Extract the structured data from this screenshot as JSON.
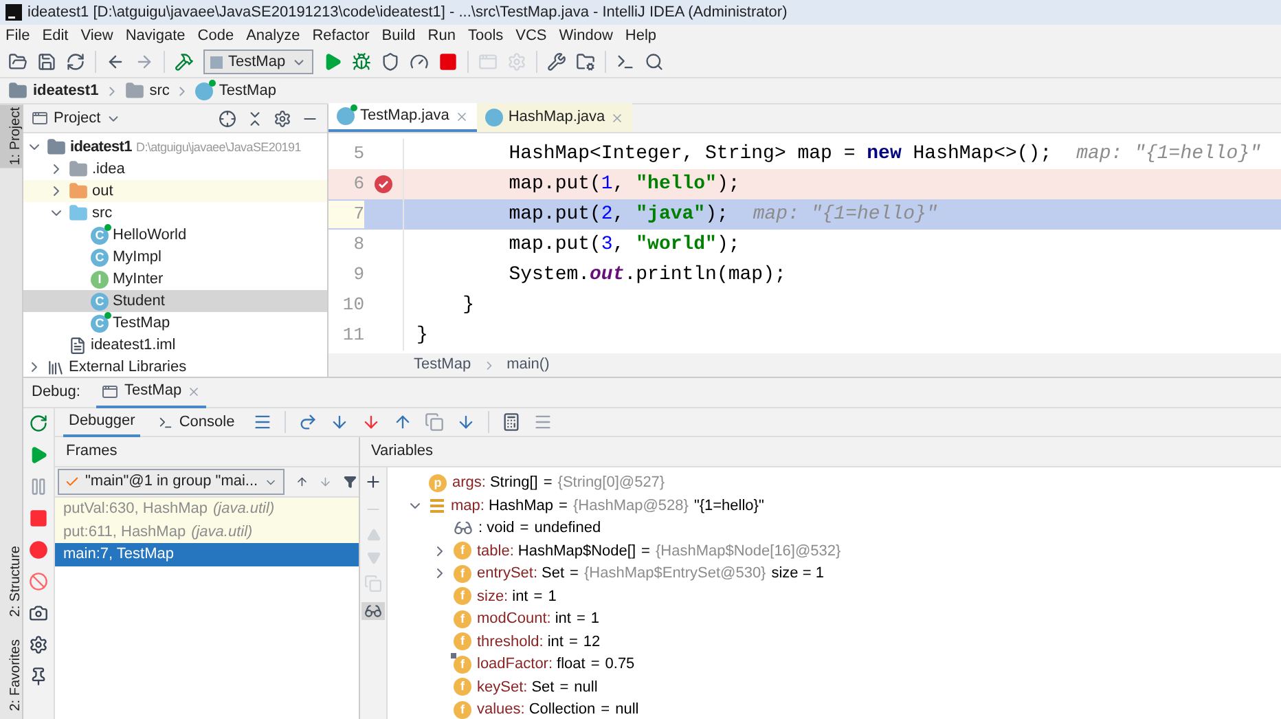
{
  "window": {
    "title": "ideatest1 [D:\\atguigu\\javaee\\JavaSE20191213\\code\\ideatest1] - ...\\src\\TestMap.java - IntelliJ IDEA (Administrator)"
  },
  "menu": [
    "File",
    "Edit",
    "View",
    "Navigate",
    "Code",
    "Analyze",
    "Refactor",
    "Build",
    "Run",
    "Tools",
    "VCS",
    "Window",
    "Help"
  ],
  "toolbar": {
    "run_config": "TestMap"
  },
  "breadcrumb": [
    {
      "label": "ideatest1",
      "kind": "module"
    },
    {
      "label": "src",
      "kind": "folder"
    },
    {
      "label": "TestMap",
      "kind": "class"
    }
  ],
  "tool_stripe": [
    {
      "label": "1: Project",
      "selected": true
    },
    {
      "label": "2: Structure",
      "selected": false
    },
    {
      "label": "2: Favorites",
      "selected": false
    }
  ],
  "project": {
    "title": "Project",
    "tree": [
      {
        "label": "ideatest1",
        "path": "D:\\atguigu\\javaee\\JavaSE20191",
        "kind": "module",
        "expanded": true,
        "selected": false,
        "children": [
          {
            "label": ".idea",
            "kind": "folder",
            "expanded": false,
            "selected": false
          },
          {
            "label": "out",
            "kind": "excluded",
            "expanded": false,
            "selected": false
          },
          {
            "label": "src",
            "kind": "source",
            "expanded": true,
            "selected": false,
            "children": [
              {
                "label": "HelloWorld",
                "kind": "main-class",
                "badge": "C",
                "selected": false
              },
              {
                "label": "MyImpl",
                "kind": "class",
                "badge": "C",
                "selected": false
              },
              {
                "label": "MyInter",
                "kind": "interface",
                "badge": "I",
                "selected": false
              },
              {
                "label": "Student",
                "kind": "class",
                "badge": "C",
                "selected": true
              },
              {
                "label": "TestMap",
                "kind": "main-class",
                "badge": "C",
                "selected": false
              }
            ]
          },
          {
            "label": "ideatest1.iml",
            "kind": "iml",
            "selected": false
          }
        ]
      },
      {
        "label": "External Libraries",
        "kind": "libraries",
        "expanded": false,
        "selected": false
      }
    ]
  },
  "editor": {
    "tabs": [
      {
        "label": "TestMap.java",
        "kind": "main-class",
        "selected": true
      },
      {
        "label": "HashMap.java",
        "kind": "class",
        "selected": false
      }
    ],
    "lines": [
      {
        "number": "5",
        "breakpoint": false,
        "current": false,
        "tokens": [
          {
            "kind": "plain",
            "text": "        HashMap<Integer, String> map = "
          },
          {
            "kind": "keyword",
            "text": "new"
          },
          {
            "kind": "plain",
            "text": " HashMap<>();"
          },
          {
            "kind": "hint",
            "text": "map: \"{1=hello}\""
          }
        ]
      },
      {
        "number": "6",
        "breakpoint": true,
        "current": false,
        "tokens": [
          {
            "kind": "plain",
            "text": "        map.put("
          },
          {
            "kind": "number",
            "text": "1"
          },
          {
            "kind": "plain",
            "text": ", "
          },
          {
            "kind": "string",
            "text": "\"hello\""
          },
          {
            "kind": "plain",
            "text": ");"
          }
        ]
      },
      {
        "number": "7",
        "breakpoint": false,
        "current": true,
        "tokens": [
          {
            "kind": "plain",
            "text": "        map.put("
          },
          {
            "kind": "number",
            "text": "2"
          },
          {
            "kind": "plain",
            "text": ", "
          },
          {
            "kind": "string",
            "text": "\"java\""
          },
          {
            "kind": "plain",
            "text": ");"
          },
          {
            "kind": "hint",
            "text": "map: \"{1=hello}\""
          }
        ]
      },
      {
        "number": "8",
        "breakpoint": false,
        "current": false,
        "tokens": [
          {
            "kind": "plain",
            "text": "        map.put("
          },
          {
            "kind": "number",
            "text": "3"
          },
          {
            "kind": "plain",
            "text": ", "
          },
          {
            "kind": "string",
            "text": "\"world\""
          },
          {
            "kind": "plain",
            "text": ");"
          }
        ]
      },
      {
        "number": "9",
        "breakpoint": false,
        "current": false,
        "tokens": [
          {
            "kind": "plain",
            "text": "        System."
          },
          {
            "kind": "static",
            "text": "out"
          },
          {
            "kind": "plain",
            "text": ".println(map);"
          }
        ]
      },
      {
        "number": "10",
        "breakpoint": false,
        "current": false,
        "tokens": [
          {
            "kind": "plain",
            "text": "    }"
          }
        ]
      },
      {
        "number": "11",
        "breakpoint": false,
        "current": false,
        "tokens": [
          {
            "kind": "plain",
            "text": "}"
          }
        ]
      }
    ],
    "footer": [
      "TestMap",
      "main()"
    ]
  },
  "debug": {
    "label": "Debug:",
    "session": "TestMap",
    "tabs": [
      {
        "label": "Debugger",
        "selected": true
      },
      {
        "label": "Console",
        "selected": false
      }
    ],
    "frames": {
      "title": "Frames",
      "thread": "\"main\"@1 in group \"mai...",
      "items": [
        {
          "method": "putVal:630, HashMap",
          "package": "(java.util)",
          "kind": "library",
          "selected": false
        },
        {
          "method": "put:611, HashMap",
          "package": "(java.util)",
          "kind": "library",
          "selected": false
        },
        {
          "method": "main:7, TestMap",
          "selected": true
        }
      ]
    },
    "variables": {
      "title": "Variables",
      "items": [
        {
          "kind": "param",
          "badge": "p",
          "name": "args:",
          "type": "String[]",
          "op": "=",
          "ref": "{String[0]@527}"
        },
        {
          "kind": "local",
          "name": "map:",
          "type": "HashMap",
          "op": "=",
          "ref": "{HashMap@528}",
          "value": "\"{1=hello}\"",
          "expanded": true,
          "children": [
            {
              "kind": "watch",
              "type": ": void",
              "op": "=",
              "value": "undefined"
            },
            {
              "kind": "field",
              "badge": "f",
              "name": "table:",
              "type": "HashMap$Node[]",
              "op": "=",
              "ref": "{HashMap$Node[16]@532}",
              "expanded": false
            },
            {
              "kind": "field",
              "badge": "f",
              "name": "entrySet:",
              "type": "Set",
              "op": "=",
              "ref": "{HashMap$EntrySet@530}",
              "value": "size = 1",
              "expanded": false
            },
            {
              "kind": "field",
              "badge": "f",
              "name": "size:",
              "type": "int",
              "op": "=",
              "value": "1"
            },
            {
              "kind": "field",
              "badge": "f",
              "name": "modCount:",
              "type": "int",
              "op": "=",
              "value": "1"
            },
            {
              "kind": "field",
              "badge": "f",
              "name": "threshold:",
              "type": "int",
              "op": "=",
              "value": "12"
            },
            {
              "kind": "final-field",
              "badge": "f",
              "name": "loadFactor:",
              "type": "float",
              "op": "=",
              "value": "0.75"
            },
            {
              "kind": "field",
              "badge": "f",
              "name": "keySet:",
              "type": "Set",
              "op": "=",
              "value": "null"
            },
            {
              "kind": "field",
              "badge": "f",
              "name": "values:",
              "type": "Collection",
              "op": "=",
              "value": "null"
            }
          ]
        }
      ]
    }
  }
}
